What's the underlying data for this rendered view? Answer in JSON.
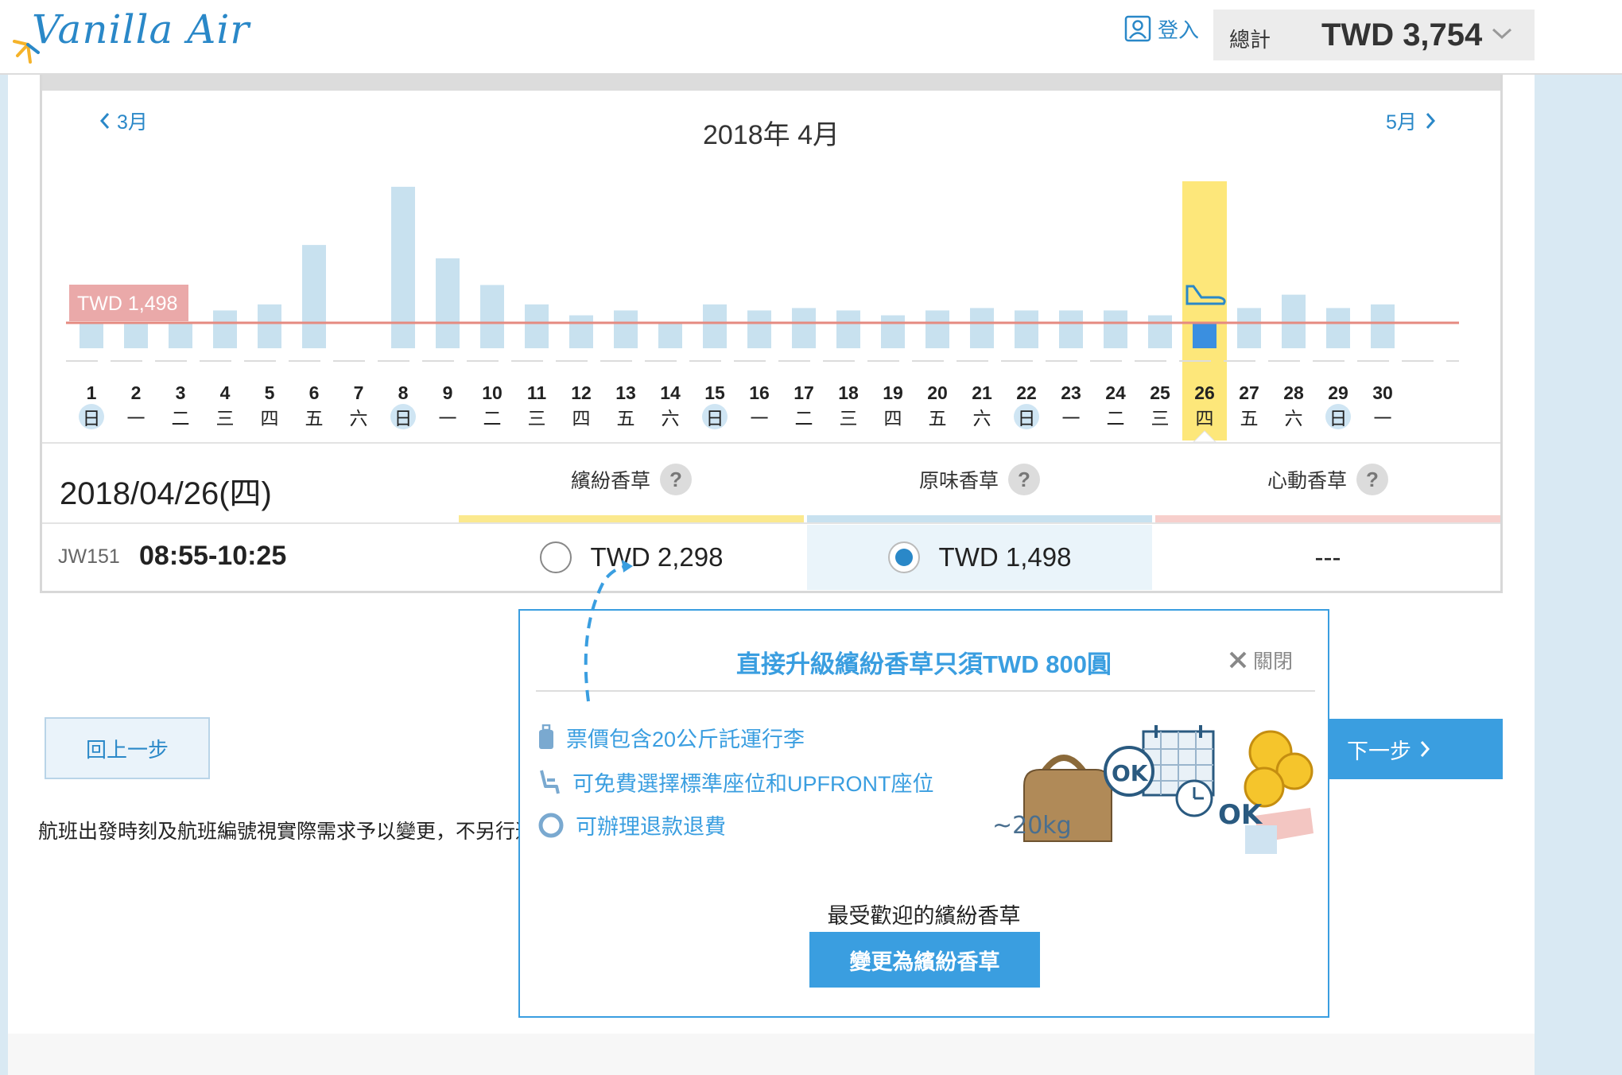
{
  "header": {
    "logo_text": "Vanilla Air",
    "login_label": "登入",
    "total_label": "總計",
    "total_value": "TWD 3,754"
  },
  "calendar": {
    "prev_month": "3月",
    "next_month": "5月",
    "month_title": "2018年 4月",
    "lowest_price_label": "TWD 1,498",
    "selected_day": 26
  },
  "chart_data": {
    "type": "bar",
    "categories": [
      "1",
      "2",
      "3",
      "4",
      "5",
      "6",
      "7",
      "8",
      "9",
      "10",
      "11",
      "12",
      "13",
      "14",
      "15",
      "16",
      "17",
      "18",
      "19",
      "20",
      "21",
      "22",
      "23",
      "24",
      "25",
      "26",
      "27",
      "28",
      "29",
      "30"
    ],
    "weekdays": [
      "日",
      "一",
      "二",
      "三",
      "四",
      "五",
      "六",
      "日",
      "一",
      "二",
      "三",
      "四",
      "五",
      "六",
      "日",
      "一",
      "二",
      "三",
      "四",
      "五",
      "六",
      "日",
      "一",
      "二",
      "三",
      "四",
      "五",
      "六",
      "日",
      "一"
    ],
    "sundays": [
      1,
      8,
      15,
      22,
      29
    ],
    "values": [
      1498,
      1498,
      1498,
      1600,
      1650,
      2140,
      null,
      2620,
      2030,
      1810,
      1650,
      1560,
      1600,
      1498,
      1650,
      1600,
      1620,
      1600,
      1560,
      1600,
      1620,
      1600,
      1600,
      1600,
      1560,
      1498,
      1620,
      1730,
      1620,
      1650
    ],
    "reference_line": 1498,
    "reference_label": "TWD 1,498",
    "colors": {
      "bar": "#c8e1ef",
      "selected_bar": "#3a8fe0",
      "selected_highlight": "#fde77a",
      "reference_line": "#e58a80",
      "label_bg": "#e8a0a0"
    }
  },
  "selected_flight": {
    "date": "2018/04/26(四)",
    "flight_no": "JW151",
    "time": "08:55-10:25"
  },
  "tiers": [
    {
      "name": "繽紛香草",
      "help": "?",
      "price": "TWD 2,298",
      "selected": false,
      "color": "#fbe98e"
    },
    {
      "name": "原味香草",
      "help": "?",
      "price": "TWD 1,498",
      "selected": true,
      "color": "#c8e1ef"
    },
    {
      "name": "心動香草",
      "help": "?",
      "price": "---",
      "selected": false,
      "color": "#f7cfcc"
    }
  ],
  "nav": {
    "back_label": "回上一步",
    "next_label": "下一步"
  },
  "notice": "航班出發時刻及航班編號視實際需求予以變更，不另行通知。",
  "popup": {
    "title": "直接升級繽紛香草只須TWD 800圓",
    "close_label": "關閉",
    "features": [
      {
        "icon": "luggage-icon",
        "text": "票價包含20公斤託運行李"
      },
      {
        "icon": "seat-icon",
        "text": "可免費選擇標準座位和UPFRONT座位"
      },
      {
        "icon": "circle-icon",
        "text": "可辦理退款退費"
      }
    ],
    "illus_weight": "~20kg",
    "illus_ok": "OK",
    "subtitle": "最受歡迎的繽紛香草",
    "button_label": "變更為繽紛香草"
  }
}
